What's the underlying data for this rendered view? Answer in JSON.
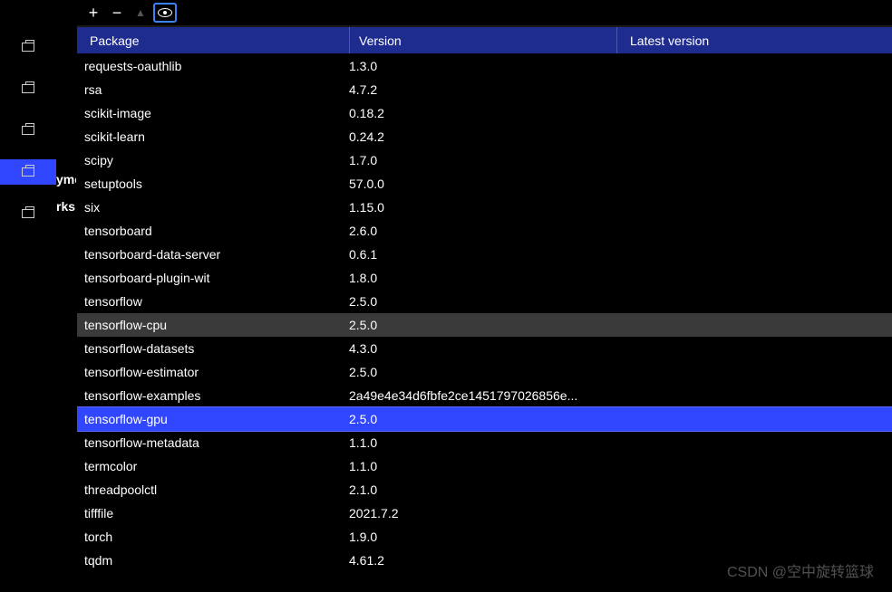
{
  "sidebar_labels": {
    "item1": "yment",
    "item2": "rks"
  },
  "columns": {
    "package": "Package",
    "version": "Version",
    "latest": "Latest version"
  },
  "packages": [
    {
      "name": "requests-oauthlib",
      "version": "1.3.0",
      "state": ""
    },
    {
      "name": "rsa",
      "version": "4.7.2",
      "state": ""
    },
    {
      "name": "scikit-image",
      "version": "0.18.2",
      "state": ""
    },
    {
      "name": "scikit-learn",
      "version": "0.24.2",
      "state": ""
    },
    {
      "name": "scipy",
      "version": "1.7.0",
      "state": ""
    },
    {
      "name": "setuptools",
      "version": "57.0.0",
      "state": ""
    },
    {
      "name": "six",
      "version": "1.15.0",
      "state": ""
    },
    {
      "name": "tensorboard",
      "version": "2.6.0",
      "state": ""
    },
    {
      "name": "tensorboard-data-server",
      "version": "0.6.1",
      "state": ""
    },
    {
      "name": "tensorboard-plugin-wit",
      "version": "1.8.0",
      "state": ""
    },
    {
      "name": "tensorflow",
      "version": "2.5.0",
      "state": ""
    },
    {
      "name": "tensorflow-cpu",
      "version": "2.5.0",
      "state": "hovered"
    },
    {
      "name": "tensorflow-datasets",
      "version": "4.3.0",
      "state": ""
    },
    {
      "name": "tensorflow-estimator",
      "version": "2.5.0",
      "state": ""
    },
    {
      "name": "tensorflow-examples",
      "version": "2a49e4e34d6fbfe2ce1451797026856e...",
      "state": ""
    },
    {
      "name": "tensorflow-gpu",
      "version": "2.5.0",
      "state": "selected"
    },
    {
      "name": "tensorflow-metadata",
      "version": "1.1.0",
      "state": ""
    },
    {
      "name": "termcolor",
      "version": "1.1.0",
      "state": ""
    },
    {
      "name": "threadpoolctl",
      "version": "2.1.0",
      "state": ""
    },
    {
      "name": "tifffile",
      "version": "2021.7.2",
      "state": ""
    },
    {
      "name": "torch",
      "version": "1.9.0",
      "state": ""
    },
    {
      "name": "tqdm",
      "version": "4.61.2",
      "state": ""
    }
  ],
  "watermark": "CSDN @空中旋转篮球"
}
